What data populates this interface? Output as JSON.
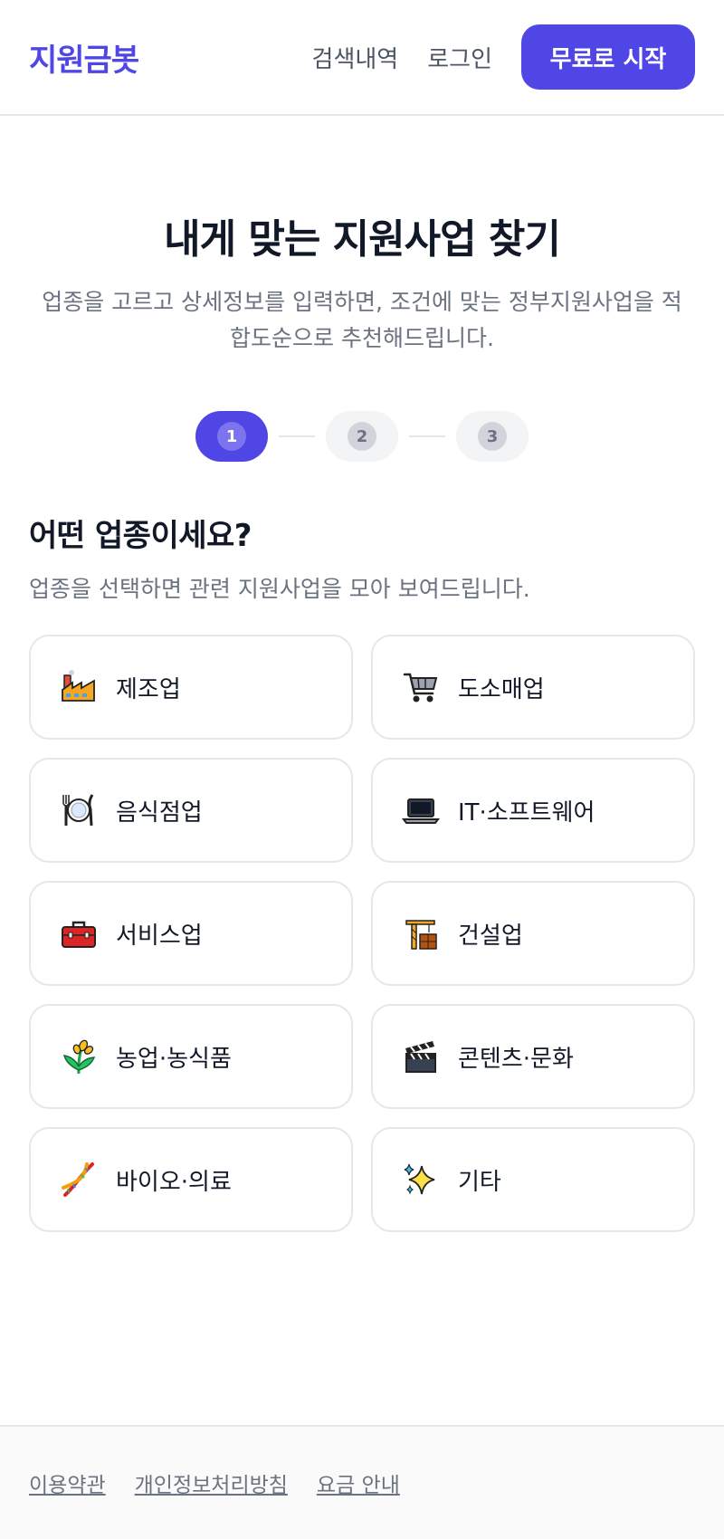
{
  "header": {
    "logo": "지원금봇",
    "nav": {
      "history": "검색내역",
      "login": "로그인",
      "cta": "무료로 시작"
    }
  },
  "hero": {
    "title": "내게 맞는 지원사업 찾기",
    "description_line1": "업종을 고르고 상세정보를 입력하면, 조건에 맞는 정부지원사업을 적",
    "description_line2": "합도순으로 추천해드립니다."
  },
  "stepper": {
    "steps": [
      "1",
      "2",
      "3"
    ],
    "active": 1
  },
  "section": {
    "title": "어떤 업종이세요?",
    "description": "업종을 선택하면 관련 지원사업을 모아 보여드립니다."
  },
  "industries": [
    {
      "label": "제조업",
      "icon": "factory-icon"
    },
    {
      "label": "도소매업",
      "icon": "shopping-cart-icon"
    },
    {
      "label": "음식점업",
      "icon": "plate-cutlery-icon"
    },
    {
      "label": "IT·소프트웨어",
      "icon": "laptop-icon"
    },
    {
      "label": "서비스업",
      "icon": "toolbox-icon"
    },
    {
      "label": "건설업",
      "icon": "crane-icon"
    },
    {
      "label": "농업·농식품",
      "icon": "rice-plant-icon"
    },
    {
      "label": "콘텐츠·문화",
      "icon": "clapper-board-icon"
    },
    {
      "label": "바이오·의료",
      "icon": "dna-icon"
    },
    {
      "label": "기타",
      "icon": "sparkles-icon"
    }
  ],
  "footer": {
    "terms": "이용약관",
    "privacy": "개인정보처리방침",
    "pricing": "요금 안내"
  },
  "colors": {
    "accent": "#4f46e5",
    "text": "#111827",
    "muted": "#6b7280",
    "border": "#e5e7eb"
  }
}
